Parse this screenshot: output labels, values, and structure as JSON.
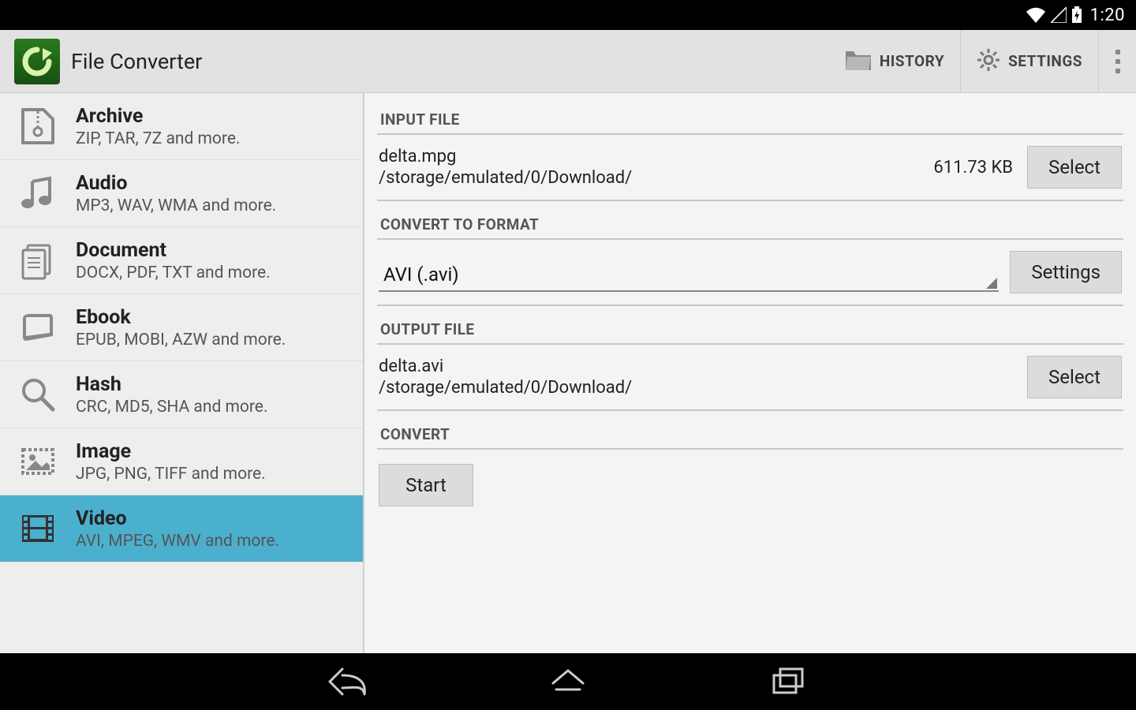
{
  "status": {
    "time": "1:20"
  },
  "app": {
    "title": "File Converter"
  },
  "actionbar": {
    "history": "HISTORY",
    "settings": "SETTINGS"
  },
  "categories": [
    {
      "id": "archive",
      "title": "Archive",
      "sub": "ZIP, TAR, 7Z and more."
    },
    {
      "id": "audio",
      "title": "Audio",
      "sub": "MP3, WAV, WMA and more."
    },
    {
      "id": "document",
      "title": "Document",
      "sub": "DOCX, PDF, TXT and more."
    },
    {
      "id": "ebook",
      "title": "Ebook",
      "sub": "EPUB, MOBI, AZW and more."
    },
    {
      "id": "hash",
      "title": "Hash",
      "sub": "CRC, MD5, SHA and more."
    },
    {
      "id": "image",
      "title": "Image",
      "sub": "JPG, PNG, TIFF and more."
    },
    {
      "id": "video",
      "title": "Video",
      "sub": "AVI, MPEG, WMV and more."
    }
  ],
  "selected_category": "video",
  "sections": {
    "input_header": "INPUT FILE",
    "convert_to_header": "CONVERT TO FORMAT",
    "output_header": "OUTPUT FILE",
    "convert_header": "CONVERT"
  },
  "input": {
    "filename": "delta.mpg",
    "path": "/storage/emulated/0/Download/",
    "size": "611.73 KB",
    "select_button": "Select"
  },
  "format": {
    "selected": "AVI (.avi)",
    "settings_button": "Settings"
  },
  "output": {
    "filename": "delta.avi",
    "path": "/storage/emulated/0/Download/",
    "select_button": "Select"
  },
  "convert": {
    "start_button": "Start"
  }
}
